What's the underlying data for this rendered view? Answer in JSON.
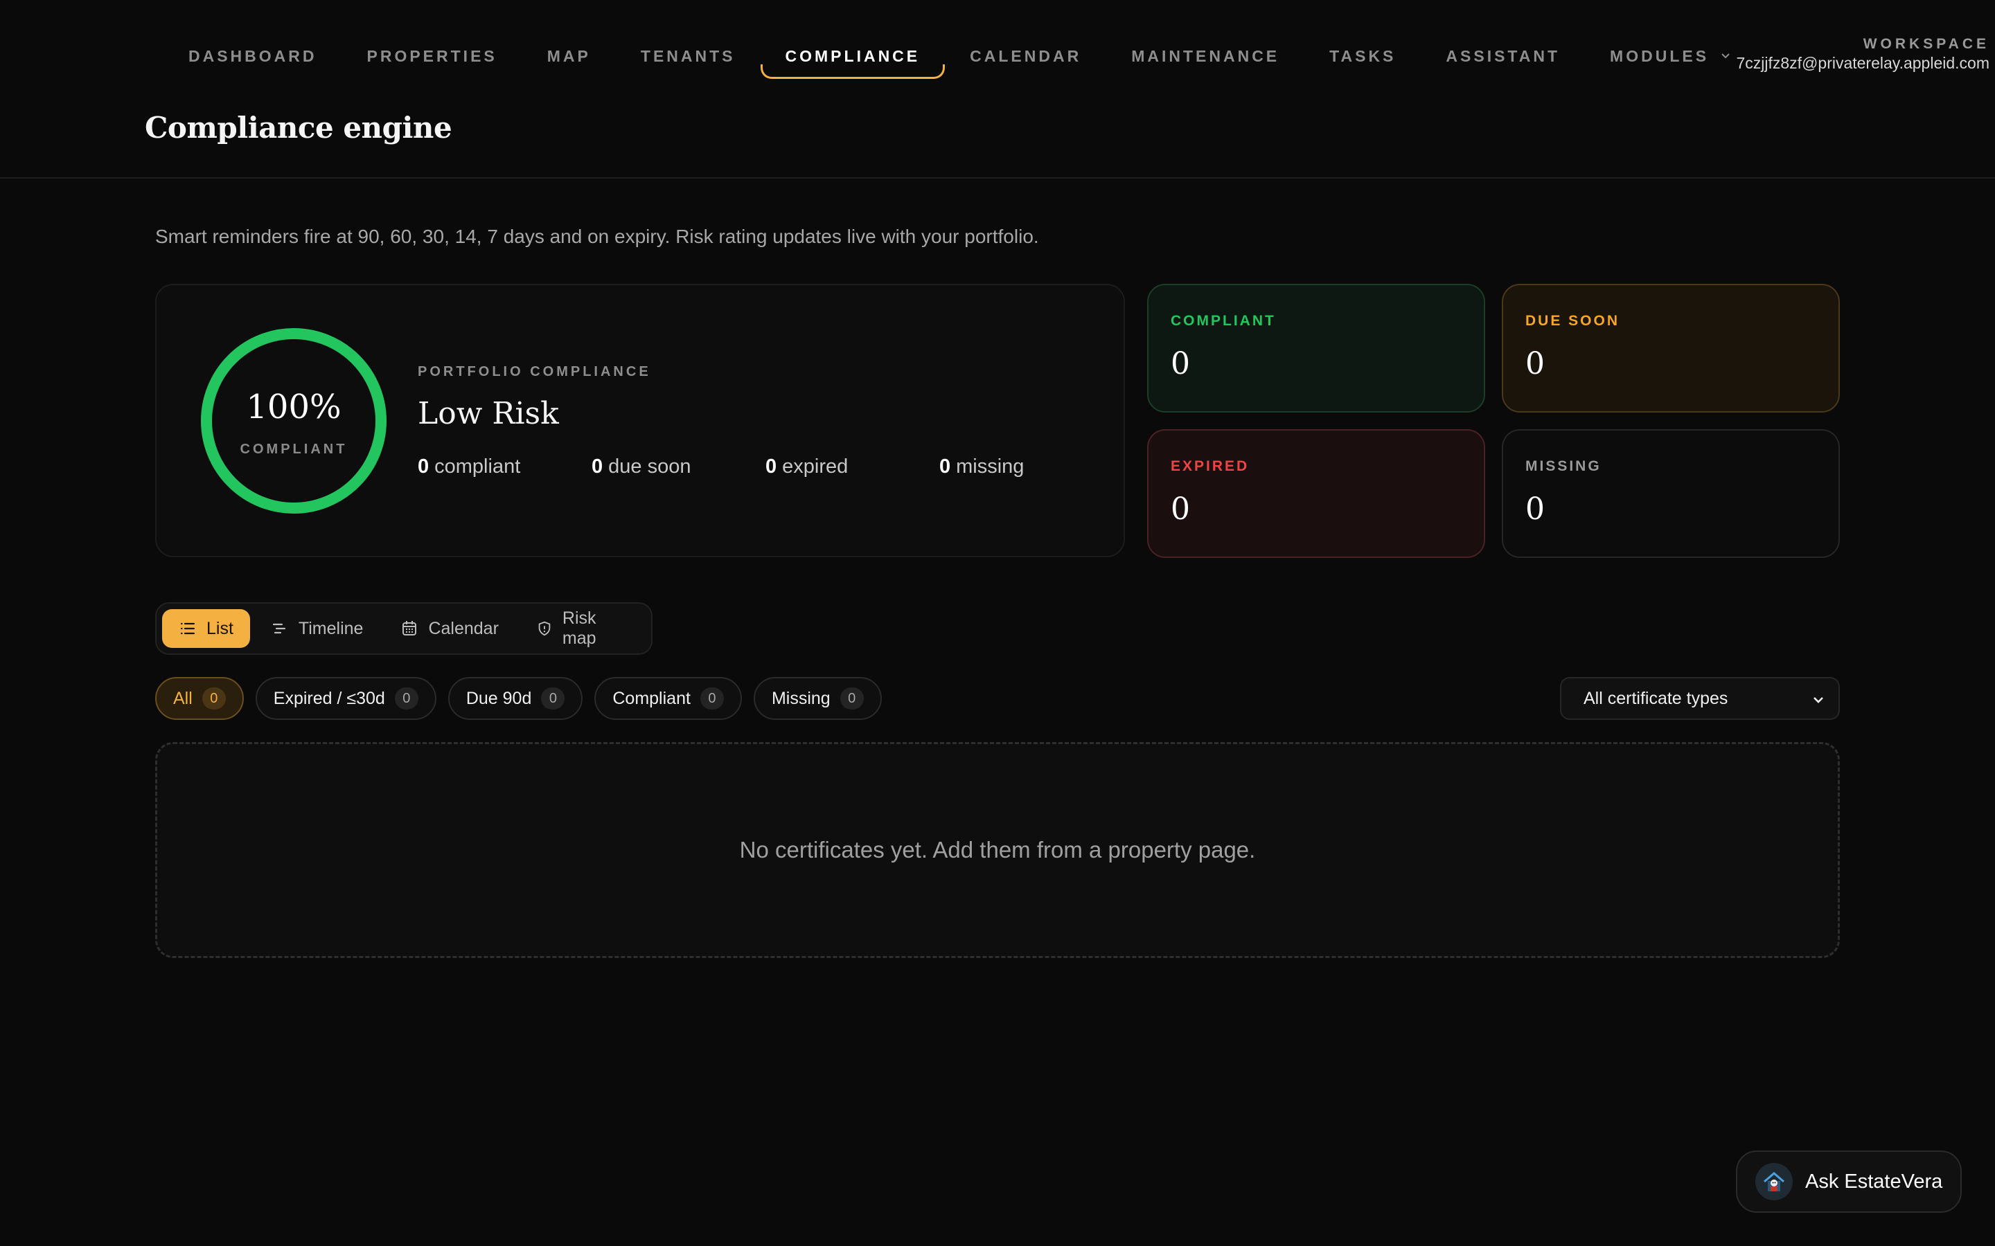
{
  "nav": {
    "items": [
      {
        "label": "DASHBOARD"
      },
      {
        "label": "PROPERTIES"
      },
      {
        "label": "MAP"
      },
      {
        "label": "TENANTS"
      },
      {
        "label": "COMPLIANCE",
        "active": true
      },
      {
        "label": "CALENDAR"
      },
      {
        "label": "MAINTENANCE"
      },
      {
        "label": "TASKS"
      },
      {
        "label": "ASSISTANT"
      },
      {
        "label": "MODULES",
        "icon": "chevron-down-icon"
      }
    ],
    "accent": "#f5b042"
  },
  "workspace": {
    "label": "WORKSPACE",
    "email": "7czjjfz8zf@privaterelay.appleid.com"
  },
  "page": {
    "title": "Compliance engine",
    "subtitle": "Smart reminders fire at 90, 60, 30, 14, 7 days and on expiry. Risk rating updates live with your portfolio."
  },
  "summary": {
    "percent": "100%",
    "percent_value": 100,
    "ring_label": "COMPLIANT",
    "ring_color": "#22c55e",
    "section_label": "PORTFOLIO COMPLIANCE",
    "risk": "Low Risk",
    "stats": [
      {
        "value": "0",
        "label": "compliant"
      },
      {
        "value": "0",
        "label": "due soon"
      },
      {
        "value": "0",
        "label": "expired"
      },
      {
        "value": "0",
        "label": "missing"
      }
    ]
  },
  "tiles": {
    "compliant": {
      "label": "COMPLIANT",
      "value": "0",
      "color": "#22c55e"
    },
    "due_soon": {
      "label": "DUE SOON",
      "value": "0",
      "color": "#f5a623"
    },
    "expired": {
      "label": "EXPIRED",
      "value": "0",
      "color": "#ef4444"
    },
    "missing": {
      "label": "MISSING",
      "value": "0",
      "color": "#9a9a9a"
    }
  },
  "views": [
    {
      "label": "List",
      "icon": "list-icon",
      "active": true
    },
    {
      "label": "Timeline",
      "icon": "timeline-icon"
    },
    {
      "label": "Calendar",
      "icon": "calendar-icon"
    },
    {
      "label": "Risk map",
      "icon": "shield-icon"
    }
  ],
  "filters": [
    {
      "label": "All",
      "count": "0",
      "active": true
    },
    {
      "label": "Expired / ≤30d",
      "count": "0"
    },
    {
      "label": "Due 90d",
      "count": "0"
    },
    {
      "label": "Compliant",
      "count": "0"
    },
    {
      "label": "Missing",
      "count": "0"
    }
  ],
  "certificate_select": {
    "value": "All certificate types"
  },
  "empty_state": "No certificates yet. Add them from a property page.",
  "assistant": {
    "label": "Ask EstateVera"
  }
}
